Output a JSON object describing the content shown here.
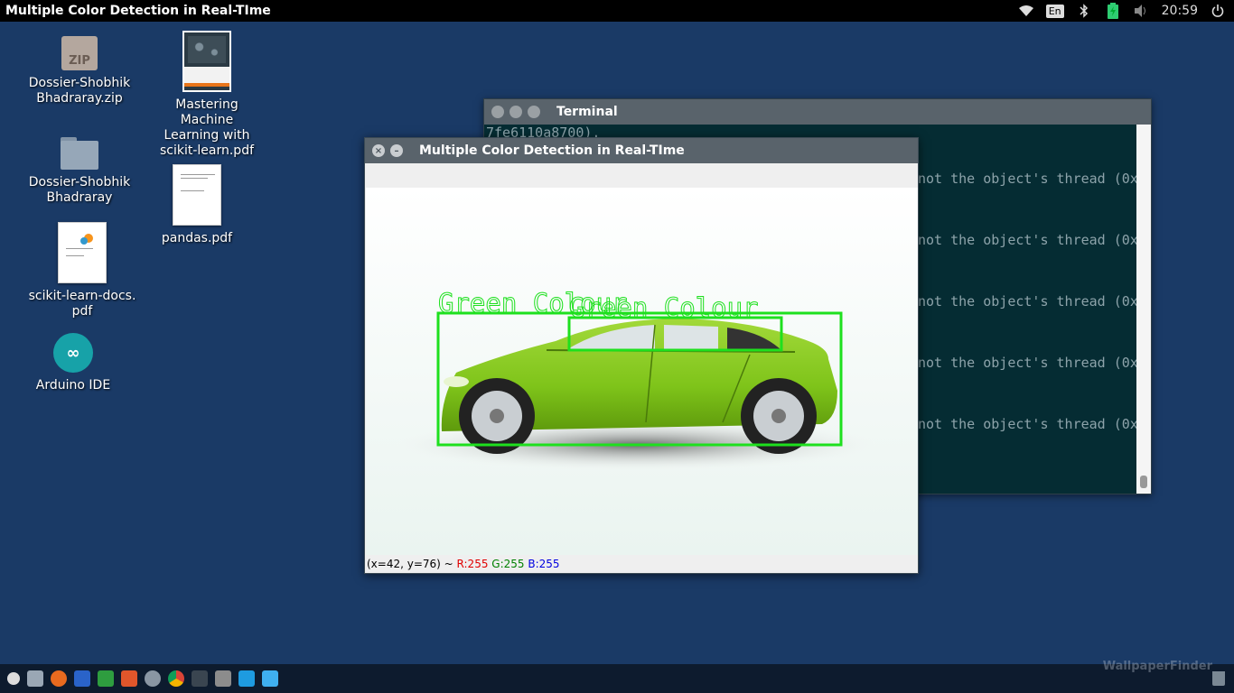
{
  "top_panel": {
    "title": "Multiple Color Detection in Real-TIme",
    "keyboard_layout": "En",
    "clock": "20:59"
  },
  "desktop": {
    "icons": [
      {
        "label": "Dossier-Shobhik Bhadraray.zip",
        "icon": "zip-archive-icon",
        "glyph": "ZIP"
      },
      {
        "label": "Dossier-Shobhik Bhadraray",
        "icon": "folder-icon"
      },
      {
        "label": "scikit-learn-docs. pdf",
        "icon": "pdf-document-icon"
      },
      {
        "label": "Arduino IDE",
        "icon": "arduino-icon",
        "glyph": "∞"
      },
      {
        "label": "Mastering Machine Learning with scikit-learn.pdf",
        "icon": "book-cover-icon"
      },
      {
        "label": "pandas.pdf",
        "icon": "pdf-document-icon"
      }
    ]
  },
  "terminal": {
    "title": "Terminal",
    "lines": [
      "7fe6110a8700).",
      "not the object's thread (0x",
      "not the object's thread (0x",
      "not the object's thread (0x",
      "not the object's thread (0x",
      "not the object's thread (0x"
    ]
  },
  "cv_window": {
    "title": "Multiple Color Detection in Real-TIme",
    "detections": [
      {
        "label": "Green Colour"
      },
      {
        "label": "Green Colour"
      }
    ],
    "status": {
      "coords": "(x=42, y=76) ~",
      "r": "R:255",
      "g": "G:255",
      "b": "B:255"
    },
    "colors": {
      "box": "#1ee01e",
      "car_body": "#7fc41a",
      "r_text": "#e00000",
      "g_text": "#008000",
      "b_text": "#0000e0"
    }
  },
  "taskbar": {
    "icons": [
      "menu-icon",
      "files-icon",
      "firefox-icon",
      "writer-icon",
      "calc-icon",
      "impress-icon",
      "settings-icon",
      "chrome-icon",
      "terminal-icon",
      "help-icon",
      "window-icon",
      "window-icon-active"
    ]
  },
  "watermark": "WallpaperFinder"
}
